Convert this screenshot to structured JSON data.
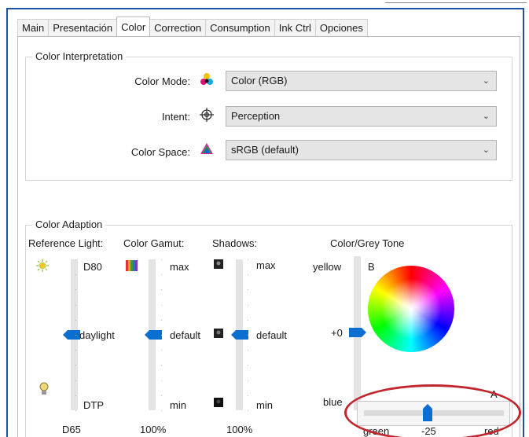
{
  "tabs": [
    {
      "label": "Main"
    },
    {
      "label": "Presentación"
    },
    {
      "label": "Color"
    },
    {
      "label": "Correction"
    },
    {
      "label": "Consumption"
    },
    {
      "label": "Ink Ctrl"
    },
    {
      "label": "Opciones"
    }
  ],
  "active_tab": "Color",
  "interpretation": {
    "title": "Color Interpretation",
    "color_mode": {
      "label": "Color Mode:",
      "value": "Color (RGB)",
      "icon": "color-dots-icon"
    },
    "intent": {
      "label": "Intent:",
      "value": "Perception",
      "icon": "crosshair-icon"
    },
    "color_space": {
      "label": "Color Space:",
      "value": "sRGB (default)",
      "icon": "gamut-triangle-icon"
    }
  },
  "adaption": {
    "title": "Color Adaption",
    "reference_light": {
      "header": "Reference Light:",
      "top": "D80",
      "middle": "daylight",
      "bottom": "DTP",
      "footer": "D65",
      "top_icon": "sun-icon",
      "bottom_icon": "lightbulb-icon",
      "level": 0.5
    },
    "gamut": {
      "header": "Color Gamut:",
      "top": "max",
      "middle": "default",
      "bottom": "min",
      "footer": "100%",
      "icon": "color-bars-icon",
      "level": 0.5
    },
    "shadows": {
      "header": "Shadows:",
      "top": "max",
      "middle": "default",
      "bottom": "min",
      "footer": "100%",
      "icon": "shadow-square-icon",
      "level": 0.5
    },
    "tone": {
      "header": "Color/Grey Tone",
      "top_label": "yellow",
      "top_letter": "B",
      "value": "+0",
      "bottom_label": "blue",
      "corner_letter": "A",
      "left_label": "green",
      "h_value": "-25",
      "right_label": "red",
      "h_level": 0.4
    }
  },
  "colors": {
    "accent": "#0a6fd1",
    "frame": "#1f4fa8",
    "annotation": "#c1272d"
  }
}
